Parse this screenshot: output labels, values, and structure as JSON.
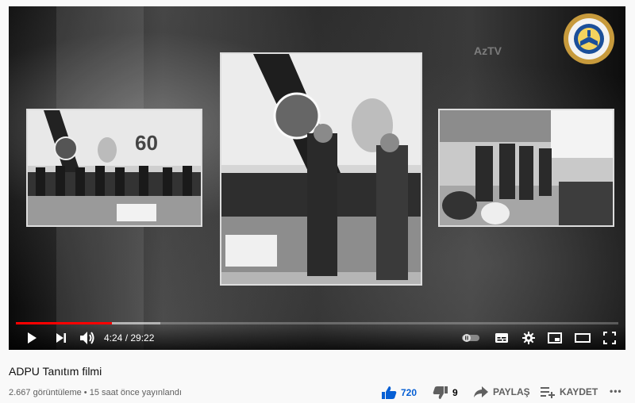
{
  "player": {
    "current_time": "4:24",
    "duration": "29:22",
    "time_separator": " / ",
    "progress_fraction": 0.16,
    "buffered_fraction": 0.24,
    "accent_color": "#ff0000",
    "watermark": "AzTV"
  },
  "icons": {
    "play": "play-icon",
    "next": "next-icon",
    "volume": "volume-icon",
    "autoplay": "autoplay-toggle-icon",
    "subtitles": "subtitles-icon",
    "settings": "gear-icon",
    "miniplayer": "miniplayer-icon",
    "theater": "theater-icon",
    "fullscreen": "fullscreen-icon"
  },
  "video": {
    "title": "ADPU Tanıtım filmi",
    "meta": "2.667 görüntüleme • 15 saat önce yayınlandı"
  },
  "actions": {
    "likes": "720",
    "dislikes": "9",
    "share": "PAYLAŞ",
    "save": "KAYDET",
    "more": "•••"
  }
}
